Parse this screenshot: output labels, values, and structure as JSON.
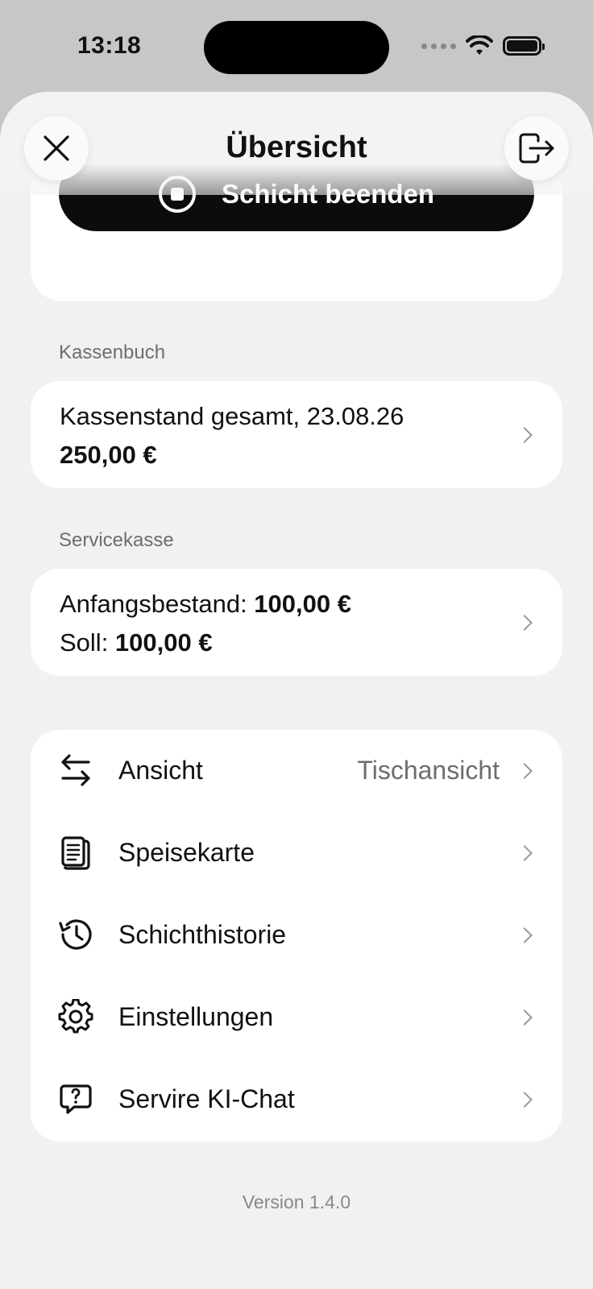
{
  "status_bar": {
    "time": "13:18"
  },
  "header": {
    "title": "Übersicht"
  },
  "end_shift": {
    "label": "Schicht beenden"
  },
  "kassenbuch": {
    "section_label": "Kassenbuch",
    "line1": "Kassenstand gesamt, 23.08.26",
    "amount": "250,00 €"
  },
  "servicekasse": {
    "section_label": "Servicekasse",
    "start_label": "Anfangsbestand: ",
    "start_amount": "100,00 €",
    "soll_label": "Soll: ",
    "soll_amount": "100,00 €"
  },
  "menu": {
    "items": [
      {
        "label": "Ansicht",
        "value": "Tischansicht",
        "icon": "arrows-swap-icon"
      },
      {
        "label": "Speisekarte",
        "value": "",
        "icon": "menu-document-icon"
      },
      {
        "label": "Schichthistorie",
        "value": "",
        "icon": "history-icon"
      },
      {
        "label": "Einstellungen",
        "value": "",
        "icon": "gear-icon"
      },
      {
        "label": "Servire KI-Chat",
        "value": "",
        "icon": "chat-question-icon"
      }
    ]
  },
  "footer": {
    "version": "Version 1.4.0"
  },
  "colors": {
    "background": "#f2f1f0",
    "card": "#ffffff",
    "primary_button": "#0e0c0b",
    "muted_text": "#6f6d6b"
  }
}
